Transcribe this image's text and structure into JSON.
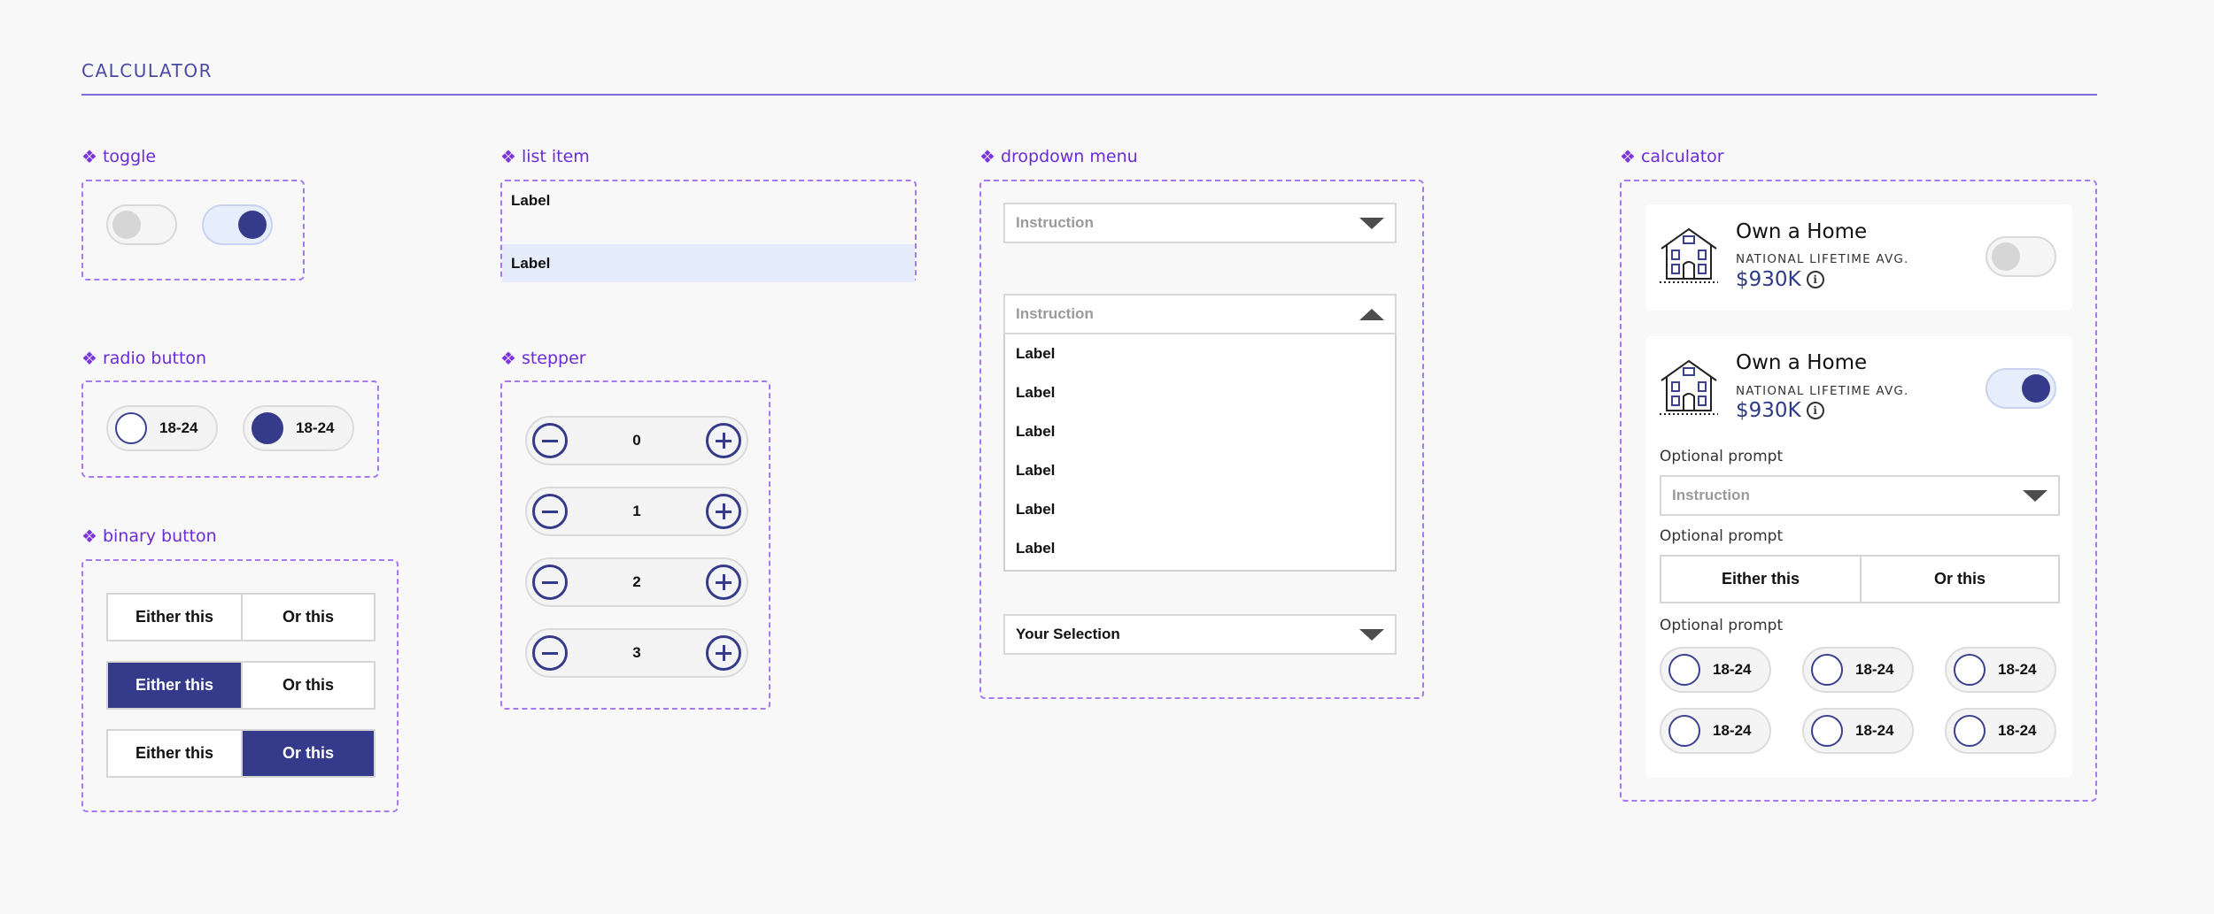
{
  "page": {
    "title": "CALCULATOR"
  },
  "sections": {
    "toggle": "toggle",
    "list_item": "list item",
    "dropdown_menu": "dropdown menu",
    "calculator": "calculator",
    "radio_button": "radio button",
    "stepper": "stepper",
    "binary_button": "binary button"
  },
  "section_glyph": "❖",
  "toggles": [
    {
      "state": "off"
    },
    {
      "state": "on"
    }
  ],
  "list_items": [
    {
      "label": "Label",
      "selected": false
    },
    {
      "label": "Label",
      "selected": true
    }
  ],
  "radios": [
    {
      "label": "18-24",
      "selected": false
    },
    {
      "label": "18-24",
      "selected": true
    }
  ],
  "binary_buttons": [
    {
      "left": "Either this",
      "right": "Or this",
      "active": "none"
    },
    {
      "left": "Either this",
      "right": "Or this",
      "active": "left"
    },
    {
      "left": "Either this",
      "right": "Or this",
      "active": "right"
    }
  ],
  "steppers": [
    {
      "value": "0"
    },
    {
      "value": "1"
    },
    {
      "value": "2"
    },
    {
      "value": "3"
    }
  ],
  "dropdown": {
    "closed_placeholder": "Instruction",
    "open_placeholder": "Instruction",
    "options": [
      "Label",
      "Label",
      "Label",
      "Label",
      "Label",
      "Label"
    ],
    "selected_value": "Your Selection"
  },
  "calculator": {
    "collapsed": {
      "title": "Own a Home",
      "subtitle": "NATIONAL LIFETIME AVG.",
      "price": "$930K",
      "toggle": "off"
    },
    "expanded": {
      "title": "Own a Home",
      "subtitle": "NATIONAL LIFETIME AVG.",
      "price": "$930K",
      "toggle": "on",
      "prompt_dropdown": "Optional prompt",
      "dropdown_placeholder": "Instruction",
      "prompt_binary": "Optional prompt",
      "binary_left": "Either this",
      "binary_right": "Or this",
      "prompt_radio": "Optional prompt",
      "radio_options": [
        "18-24",
        "18-24",
        "18-24",
        "18-24",
        "18-24",
        "18-24"
      ]
    }
  },
  "info_glyph": "i",
  "colors": {
    "accent": "#353b8a",
    "frame": "#a778f2",
    "label": "#6b2bd9",
    "selected_row": "#e5ecfb"
  }
}
